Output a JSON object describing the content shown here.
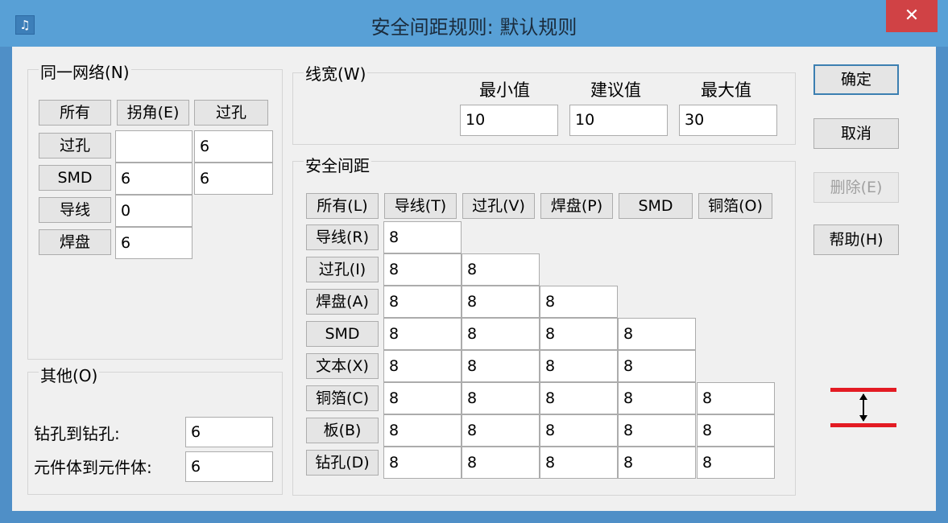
{
  "title": "安全间距规则: 默认规则",
  "app_icon_glyph": "♫",
  "close_glyph": "✕",
  "same_net": {
    "legend": "同一网络(N)",
    "headers": [
      "所有",
      "拐角(E)",
      "过孔"
    ],
    "rows": [
      {
        "label": "过孔",
        "corner": "",
        "via": "6"
      },
      {
        "label": "SMD",
        "corner": "6",
        "via": "6"
      },
      {
        "label": "导线",
        "corner": "0"
      },
      {
        "label": "焊盘",
        "corner": "6"
      }
    ]
  },
  "other": {
    "legend": "其他(O)",
    "drill_to_drill_label": "钻孔到钻孔:",
    "drill_to_drill_value": "6",
    "body_to_body_label": "元件体到元件体:",
    "body_to_body_value": "6"
  },
  "trace_width": {
    "legend": "线宽(W)",
    "min_label": "最小值",
    "rec_label": "建议值",
    "max_label": "最大值",
    "min_value": "10",
    "rec_value": "10",
    "max_value": "30"
  },
  "clearance": {
    "legend": "安全间距",
    "headers": [
      "所有(L)",
      "导线(T)",
      "过孔(V)",
      "焊盘(P)",
      "SMD",
      "铜箔(O)"
    ],
    "rows": [
      {
        "label": "导线(R)",
        "values": [
          "8"
        ]
      },
      {
        "label": "过孔(I)",
        "values": [
          "8",
          "8"
        ]
      },
      {
        "label": "焊盘(A)",
        "values": [
          "8",
          "8",
          "8"
        ]
      },
      {
        "label": "SMD",
        "values": [
          "8",
          "8",
          "8",
          "8"
        ]
      },
      {
        "label": "文本(X)",
        "values": [
          "8",
          "8",
          "8",
          "8"
        ]
      },
      {
        "label": "铜箔(C)",
        "values": [
          "8",
          "8",
          "8",
          "8",
          "8"
        ]
      },
      {
        "label": "板(B)",
        "values": [
          "8",
          "8",
          "8",
          "8",
          "8"
        ]
      },
      {
        "label": "钻孔(D)",
        "values": [
          "8",
          "8",
          "8",
          "8",
          "8"
        ]
      }
    ]
  },
  "buttons": {
    "ok": "确定",
    "cancel": "取消",
    "delete": "删除(E)",
    "help": "帮助(H)"
  },
  "colors": {
    "titlebar": "#58a0d6",
    "close": "#d04245",
    "illustration_line": "#e31b23"
  },
  "illustration_icon": "clearance-arrow-icon"
}
